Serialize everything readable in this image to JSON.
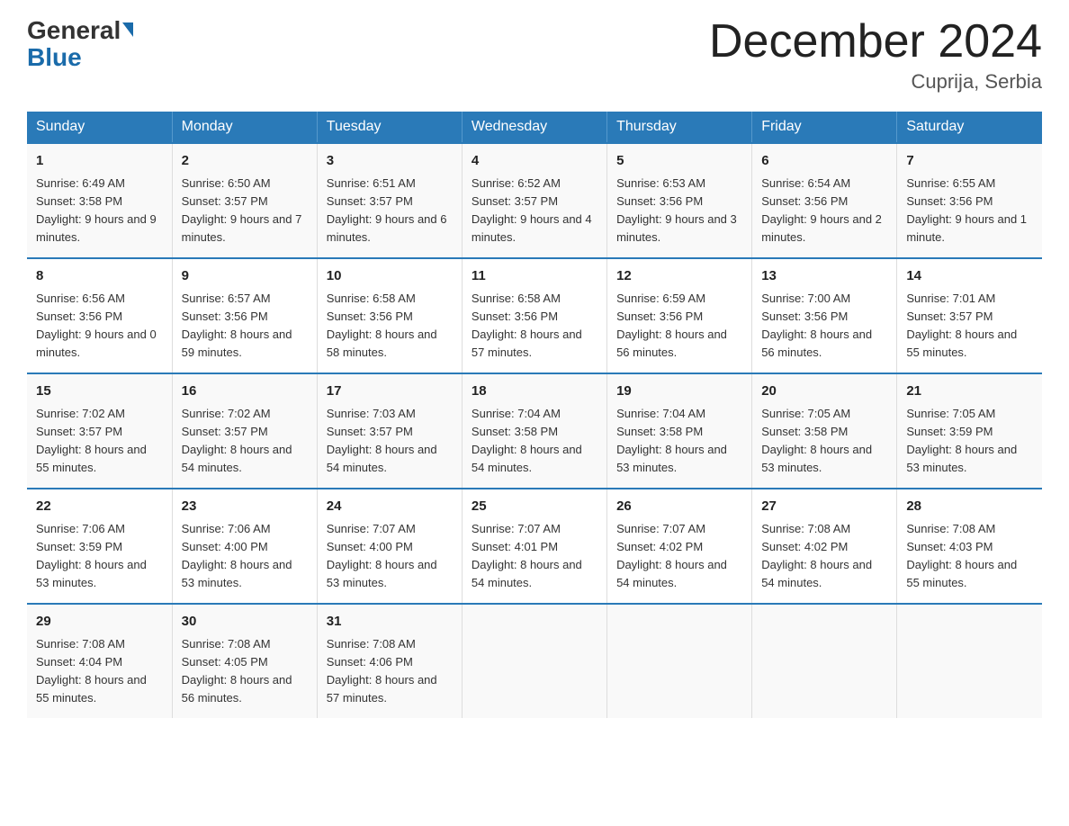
{
  "header": {
    "logo_general": "General",
    "logo_blue": "Blue",
    "title": "December 2024",
    "subtitle": "Cuprija, Serbia"
  },
  "days_of_week": [
    "Sunday",
    "Monday",
    "Tuesday",
    "Wednesday",
    "Thursday",
    "Friday",
    "Saturday"
  ],
  "weeks": [
    [
      {
        "day": "1",
        "sunrise": "6:49 AM",
        "sunset": "3:58 PM",
        "daylight": "9 hours and 9 minutes."
      },
      {
        "day": "2",
        "sunrise": "6:50 AM",
        "sunset": "3:57 PM",
        "daylight": "9 hours and 7 minutes."
      },
      {
        "day": "3",
        "sunrise": "6:51 AM",
        "sunset": "3:57 PM",
        "daylight": "9 hours and 6 minutes."
      },
      {
        "day": "4",
        "sunrise": "6:52 AM",
        "sunset": "3:57 PM",
        "daylight": "9 hours and 4 minutes."
      },
      {
        "day": "5",
        "sunrise": "6:53 AM",
        "sunset": "3:56 PM",
        "daylight": "9 hours and 3 minutes."
      },
      {
        "day": "6",
        "sunrise": "6:54 AM",
        "sunset": "3:56 PM",
        "daylight": "9 hours and 2 minutes."
      },
      {
        "day": "7",
        "sunrise": "6:55 AM",
        "sunset": "3:56 PM",
        "daylight": "9 hours and 1 minute."
      }
    ],
    [
      {
        "day": "8",
        "sunrise": "6:56 AM",
        "sunset": "3:56 PM",
        "daylight": "9 hours and 0 minutes."
      },
      {
        "day": "9",
        "sunrise": "6:57 AM",
        "sunset": "3:56 PM",
        "daylight": "8 hours and 59 minutes."
      },
      {
        "day": "10",
        "sunrise": "6:58 AM",
        "sunset": "3:56 PM",
        "daylight": "8 hours and 58 minutes."
      },
      {
        "day": "11",
        "sunrise": "6:58 AM",
        "sunset": "3:56 PM",
        "daylight": "8 hours and 57 minutes."
      },
      {
        "day": "12",
        "sunrise": "6:59 AM",
        "sunset": "3:56 PM",
        "daylight": "8 hours and 56 minutes."
      },
      {
        "day": "13",
        "sunrise": "7:00 AM",
        "sunset": "3:56 PM",
        "daylight": "8 hours and 56 minutes."
      },
      {
        "day": "14",
        "sunrise": "7:01 AM",
        "sunset": "3:57 PM",
        "daylight": "8 hours and 55 minutes."
      }
    ],
    [
      {
        "day": "15",
        "sunrise": "7:02 AM",
        "sunset": "3:57 PM",
        "daylight": "8 hours and 55 minutes."
      },
      {
        "day": "16",
        "sunrise": "7:02 AM",
        "sunset": "3:57 PM",
        "daylight": "8 hours and 54 minutes."
      },
      {
        "day": "17",
        "sunrise": "7:03 AM",
        "sunset": "3:57 PM",
        "daylight": "8 hours and 54 minutes."
      },
      {
        "day": "18",
        "sunrise": "7:04 AM",
        "sunset": "3:58 PM",
        "daylight": "8 hours and 54 minutes."
      },
      {
        "day": "19",
        "sunrise": "7:04 AM",
        "sunset": "3:58 PM",
        "daylight": "8 hours and 53 minutes."
      },
      {
        "day": "20",
        "sunrise": "7:05 AM",
        "sunset": "3:58 PM",
        "daylight": "8 hours and 53 minutes."
      },
      {
        "day": "21",
        "sunrise": "7:05 AM",
        "sunset": "3:59 PM",
        "daylight": "8 hours and 53 minutes."
      }
    ],
    [
      {
        "day": "22",
        "sunrise": "7:06 AM",
        "sunset": "3:59 PM",
        "daylight": "8 hours and 53 minutes."
      },
      {
        "day": "23",
        "sunrise": "7:06 AM",
        "sunset": "4:00 PM",
        "daylight": "8 hours and 53 minutes."
      },
      {
        "day": "24",
        "sunrise": "7:07 AM",
        "sunset": "4:00 PM",
        "daylight": "8 hours and 53 minutes."
      },
      {
        "day": "25",
        "sunrise": "7:07 AM",
        "sunset": "4:01 PM",
        "daylight": "8 hours and 54 minutes."
      },
      {
        "day": "26",
        "sunrise": "7:07 AM",
        "sunset": "4:02 PM",
        "daylight": "8 hours and 54 minutes."
      },
      {
        "day": "27",
        "sunrise": "7:08 AM",
        "sunset": "4:02 PM",
        "daylight": "8 hours and 54 minutes."
      },
      {
        "day": "28",
        "sunrise": "7:08 AM",
        "sunset": "4:03 PM",
        "daylight": "8 hours and 55 minutes."
      }
    ],
    [
      {
        "day": "29",
        "sunrise": "7:08 AM",
        "sunset": "4:04 PM",
        "daylight": "8 hours and 55 minutes."
      },
      {
        "day": "30",
        "sunrise": "7:08 AM",
        "sunset": "4:05 PM",
        "daylight": "8 hours and 56 minutes."
      },
      {
        "day": "31",
        "sunrise": "7:08 AM",
        "sunset": "4:06 PM",
        "daylight": "8 hours and 57 minutes."
      },
      null,
      null,
      null,
      null
    ]
  ],
  "labels": {
    "sunrise": "Sunrise:",
    "sunset": "Sunset:",
    "daylight": "Daylight:"
  }
}
